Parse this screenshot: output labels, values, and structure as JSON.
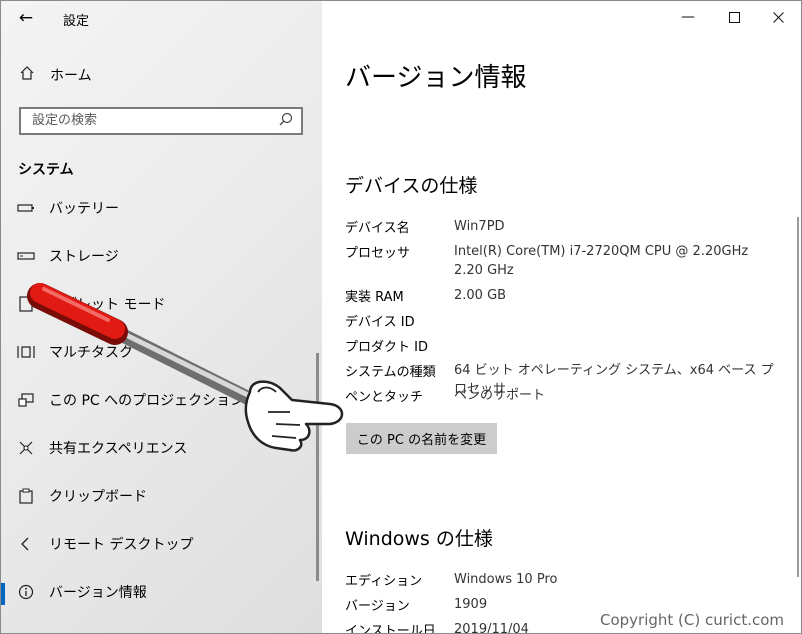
{
  "app": {
    "title": "設定",
    "back_icon": "back-arrow-icon"
  },
  "sidebar": {
    "home_label": "ホーム",
    "search": {
      "placeholder": "設定の検索"
    },
    "section": "システム",
    "items": [
      {
        "label": "バッテリー",
        "icon": "battery-icon"
      },
      {
        "label": "ストレージ",
        "icon": "storage-icon"
      },
      {
        "label": "タブレット モード",
        "icon": "tablet-mode-icon"
      },
      {
        "label": "マルチタスク",
        "icon": "multitasking-icon"
      },
      {
        "label": "この PC へのプロジェクション",
        "icon": "projection-icon"
      },
      {
        "label": "共有エクスペリエンス",
        "icon": "shared-experiences-icon"
      },
      {
        "label": "クリップボード",
        "icon": "clipboard-icon"
      },
      {
        "label": "リモート デスクトップ",
        "icon": "remote-desktop-icon"
      },
      {
        "label": "バージョン情報",
        "icon": "info-icon",
        "active": true
      }
    ]
  },
  "content": {
    "title": "バージョン情報",
    "device_spec": {
      "heading": "デバイスの仕様",
      "rows": [
        {
          "key": "デバイス名",
          "value": "Win7PD"
        },
        {
          "key": "プロセッサ",
          "value": "Intel(R) Core(TM) i7-2720QM CPU @ 2.20GHz   2.20 GHz"
        },
        {
          "key": "実装 RAM",
          "value": "2.00 GB"
        },
        {
          "key": "デバイス ID",
          "value": ""
        },
        {
          "key": "プロダクト ID",
          "value": ""
        },
        {
          "key": "システムの種類",
          "value": "64 ビット オペレーティング システム、x64 ベース プロセッサ"
        },
        {
          "key": "ペンとタッチ",
          "value": "ペンのサポート"
        }
      ],
      "rename_button": "この PC の名前を変更"
    },
    "windows_spec": {
      "heading": "Windows の仕様",
      "rows": [
        {
          "key": "エディション",
          "value": "Windows 10 Pro"
        },
        {
          "key": "バージョン",
          "value": "1909"
        },
        {
          "key": "インストール日",
          "value": "2019/11/04"
        }
      ]
    }
  },
  "watermark": "Copyright (C) curict.com",
  "colors": {
    "accent": "#0067c0",
    "button_bg": "#cccccc",
    "pointer_red": "#e11b14"
  }
}
